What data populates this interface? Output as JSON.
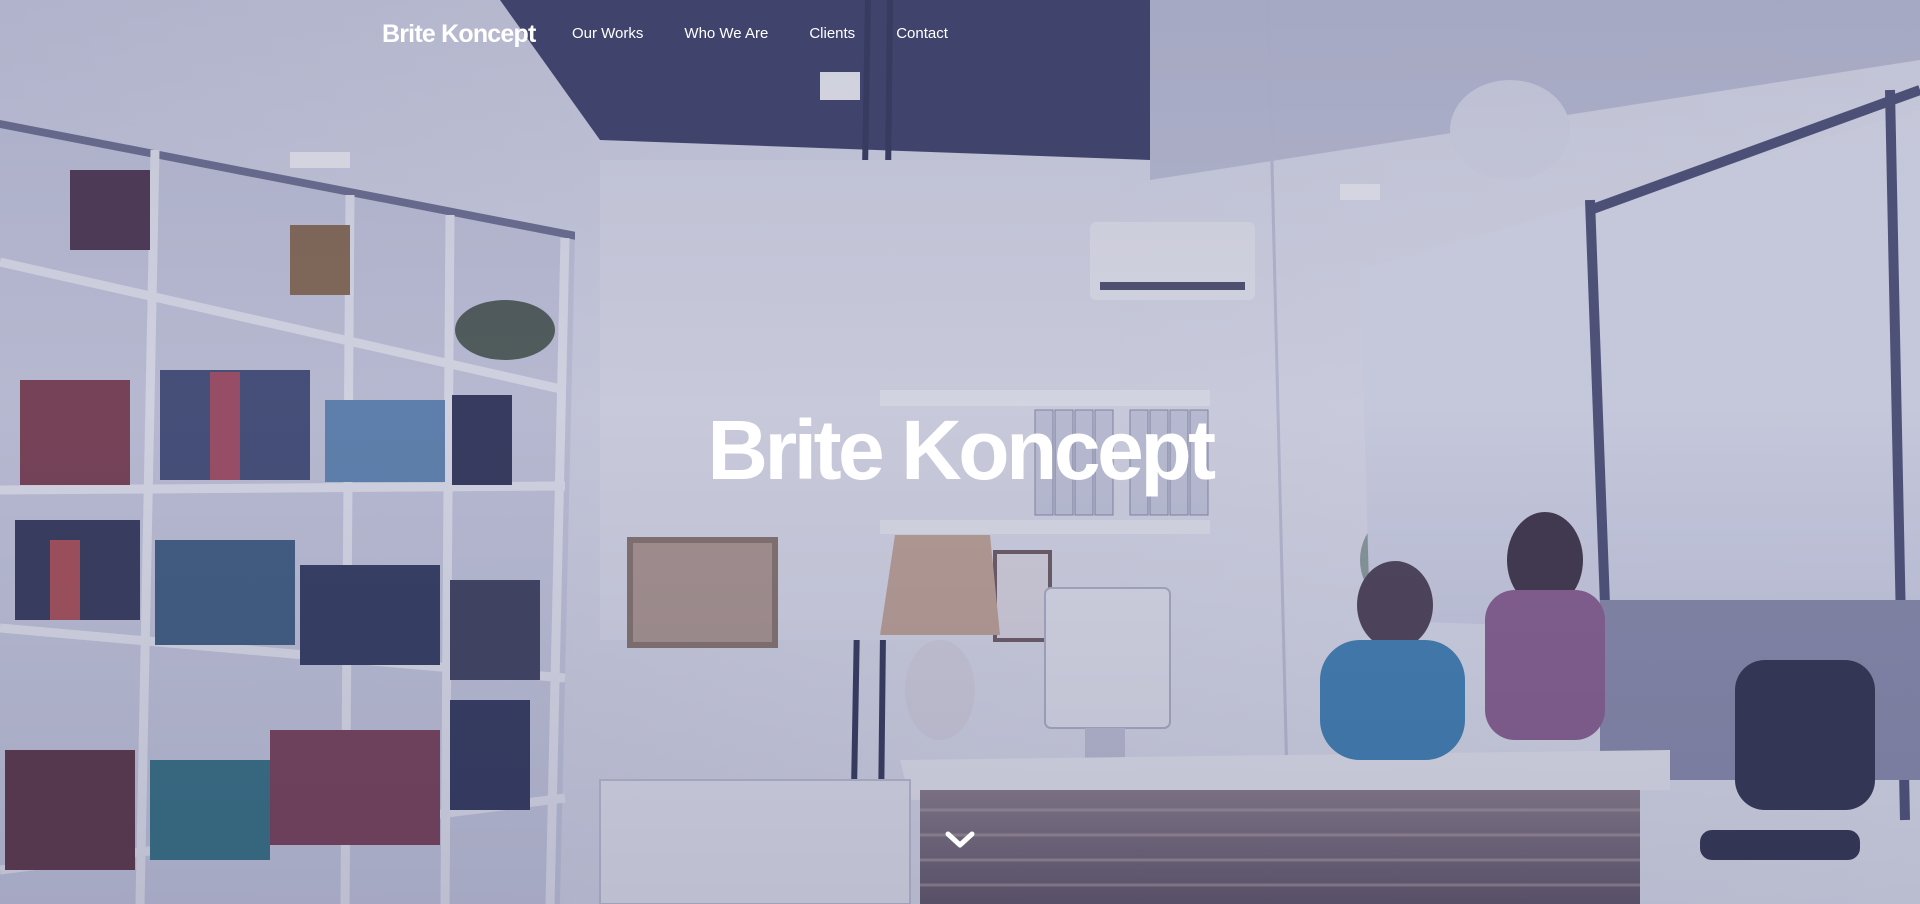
{
  "nav": {
    "brand": "Brite Koncept",
    "items": [
      {
        "label": "Our Works"
      },
      {
        "label": "Who We Are"
      },
      {
        "label": "Clients"
      },
      {
        "label": "Contact"
      }
    ]
  },
  "hero": {
    "title": "Brite Koncept",
    "scroll_icon": "chevron-down-icon",
    "overlay_color": "#5c608c"
  },
  "colors": {
    "text": "#ffffff",
    "tint": "#8f93b0"
  }
}
